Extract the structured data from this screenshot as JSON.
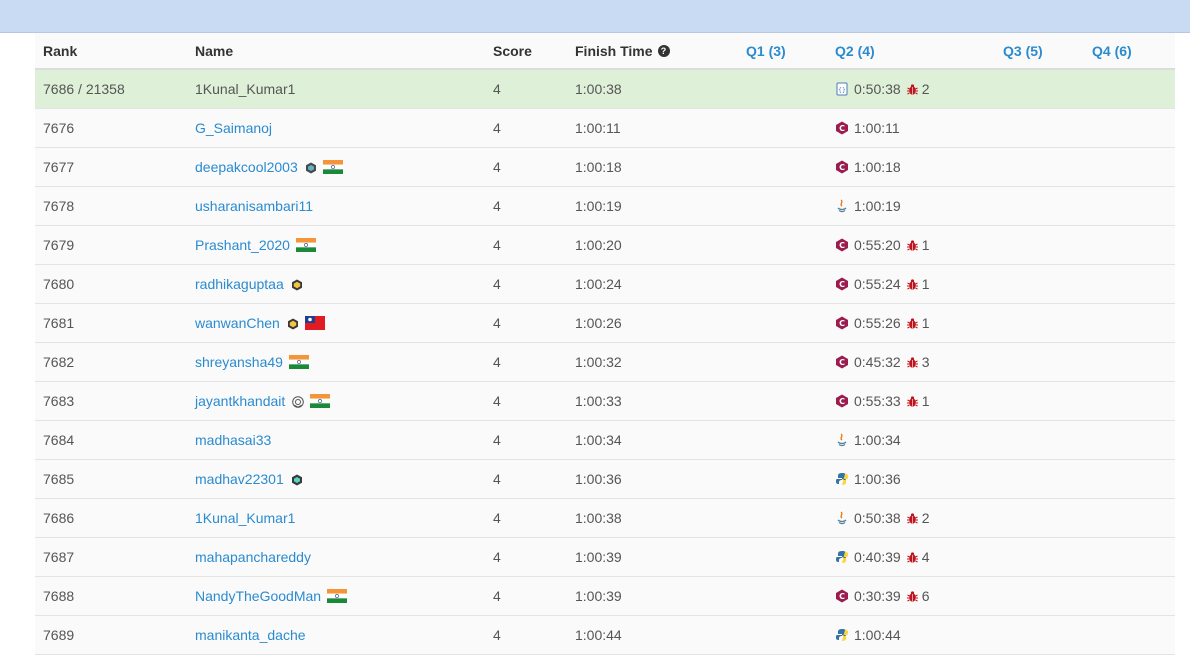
{
  "header": {
    "rank": "Rank",
    "name": "Name",
    "score": "Score",
    "finish_time": "Finish Time",
    "help_icon": "question-circle-icon",
    "q1": "Q1 (3)",
    "q2": "Q2 (4)",
    "q3": "Q3 (5)",
    "q4": "Q4 (6)"
  },
  "colors": {
    "top_bar": "#c9daf3",
    "highlight_row": "#dff0d8",
    "link": "#2a8bd0",
    "bug": "#c0141d"
  },
  "rows": [
    {
      "rank": "7686 / 21358",
      "name": "1Kunal_Kumar1",
      "score": "4",
      "finish_time": "1:00:38",
      "q2_lang": "java-file-icon",
      "q2_time": "0:50:38",
      "bugs": "2",
      "self": true,
      "badge": "",
      "flag": ""
    },
    {
      "rank": "7676",
      "name": "G_Saimanoj",
      "score": "4",
      "finish_time": "1:00:11",
      "q2_lang": "cpp-icon",
      "q2_time": "1:00:11",
      "bugs": "",
      "badge": "",
      "flag": ""
    },
    {
      "rank": "7677",
      "name": "deepakcool2003",
      "score": "4",
      "finish_time": "1:00:18",
      "q2_lang": "cpp-icon",
      "q2_time": "1:00:18",
      "bugs": "",
      "badge": "knight-badge-icon",
      "flag": "india-flag"
    },
    {
      "rank": "7678",
      "name": "usharanisambari11",
      "score": "4",
      "finish_time": "1:00:19",
      "q2_lang": "java-icon",
      "q2_time": "1:00:19",
      "bugs": "",
      "badge": "",
      "flag": ""
    },
    {
      "rank": "7679",
      "name": "Prashant_2020",
      "score": "4",
      "finish_time": "1:00:20",
      "q2_lang": "cpp-icon",
      "q2_time": "0:55:20",
      "bugs": "1",
      "badge": "",
      "flag": "india-flag"
    },
    {
      "rank": "7680",
      "name": "radhikaguptaa",
      "score": "4",
      "finish_time": "1:00:24",
      "q2_lang": "cpp-icon",
      "q2_time": "0:55:24",
      "bugs": "1",
      "badge": "guardian-badge-icon",
      "flag": ""
    },
    {
      "rank": "7681",
      "name": "wanwanChen",
      "score": "4",
      "finish_time": "1:00:26",
      "q2_lang": "cpp-icon",
      "q2_time": "0:55:26",
      "bugs": "1",
      "badge": "guardian-badge-icon",
      "flag": "taiwan-flag"
    },
    {
      "rank": "7682",
      "name": "shreyansha49",
      "score": "4",
      "finish_time": "1:00:32",
      "q2_lang": "cpp-icon",
      "q2_time": "0:45:32",
      "bugs": "3",
      "badge": "",
      "flag": "india-flag"
    },
    {
      "rank": "7683",
      "name": "jayantkhandait",
      "score": "4",
      "finish_time": "1:00:33",
      "q2_lang": "cpp-icon",
      "q2_time": "0:55:33",
      "bugs": "1",
      "badge": "laurel-badge-icon",
      "flag": "india-flag"
    },
    {
      "rank": "7684",
      "name": "madhasai33",
      "score": "4",
      "finish_time": "1:00:34",
      "q2_lang": "java-icon",
      "q2_time": "1:00:34",
      "bugs": "",
      "badge": "",
      "flag": ""
    },
    {
      "rank": "7685",
      "name": "madhav22301",
      "score": "4",
      "finish_time": "1:00:36",
      "q2_lang": "python-icon",
      "q2_time": "1:00:36",
      "bugs": "",
      "badge": "knight-teal-badge-icon",
      "flag": ""
    },
    {
      "rank": "7686",
      "name": "1Kunal_Kumar1",
      "score": "4",
      "finish_time": "1:00:38",
      "q2_lang": "java-icon",
      "q2_time": "0:50:38",
      "bugs": "2",
      "badge": "",
      "flag": ""
    },
    {
      "rank": "7687",
      "name": "mahapanchareddy",
      "score": "4",
      "finish_time": "1:00:39",
      "q2_lang": "python-icon",
      "q2_time": "0:40:39",
      "bugs": "4",
      "badge": "",
      "flag": ""
    },
    {
      "rank": "7688",
      "name": "NandyTheGoodMan",
      "score": "4",
      "finish_time": "1:00:39",
      "q2_lang": "cpp-icon",
      "q2_time": "0:30:39",
      "bugs": "6",
      "badge": "",
      "flag": "india-flag"
    },
    {
      "rank": "7689",
      "name": "manikanta_dache",
      "score": "4",
      "finish_time": "1:00:44",
      "q2_lang": "python-icon",
      "q2_time": "1:00:44",
      "bugs": "",
      "badge": "",
      "flag": ""
    }
  ]
}
